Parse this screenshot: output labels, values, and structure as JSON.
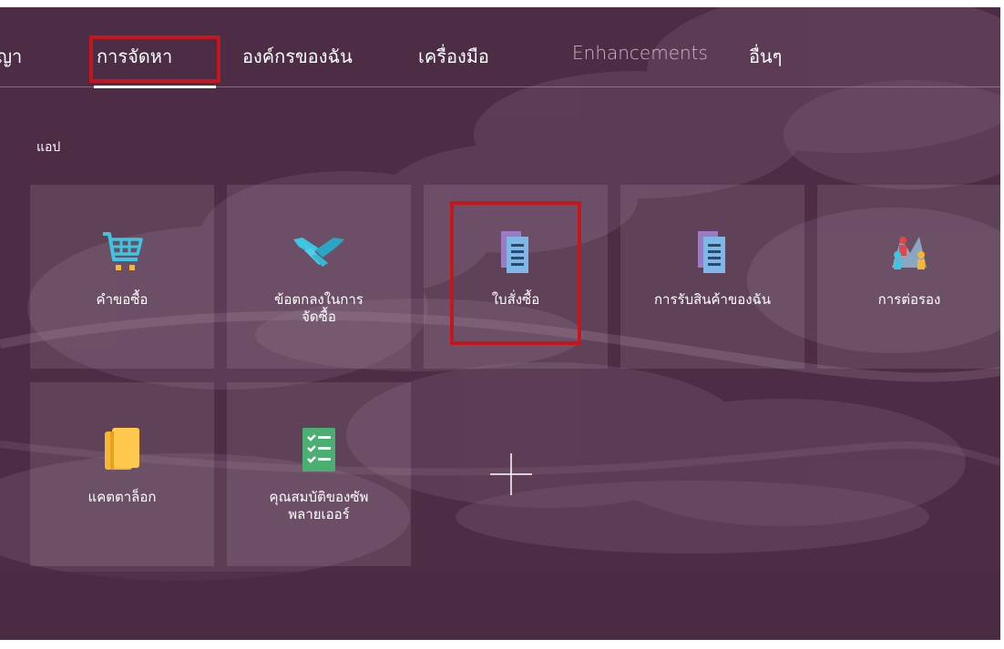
{
  "tabs": [
    {
      "label": "ญา"
    },
    {
      "label": "การจัดหา"
    },
    {
      "label": "องค์กรของฉัน"
    },
    {
      "label": "เครื่องมือ"
    },
    {
      "label": "Enhancements"
    },
    {
      "label": "อื่นๆ"
    }
  ],
  "section": {
    "title": "แอป"
  },
  "tiles": [
    {
      "label": "คำขอซื้อ",
      "icon": "shopping-cart-icon"
    },
    {
      "label": "ข้อตกลงในการ\nจัดซื้อ",
      "icon": "handshake-icon"
    },
    {
      "label": "ใบสั่งซื้อ",
      "icon": "purchase-order-document-icon"
    },
    {
      "label": "การรับสินค้าของฉัน",
      "icon": "receipt-document-icon"
    },
    {
      "label": "การต่อรอง",
      "icon": "negotiation-people-icon"
    },
    {
      "label": "แคตตาล็อก",
      "icon": "catalog-book-icon"
    },
    {
      "label": "คุณสมบัติของซัพ\nพลายเออร์",
      "icon": "checklist-icon"
    }
  ],
  "add_tile": {
    "icon": "plus-icon"
  },
  "colors": {
    "background": "#4d2d45",
    "highlight": "#c4161c",
    "tile": "rgba(255,255,255,0.10)"
  }
}
